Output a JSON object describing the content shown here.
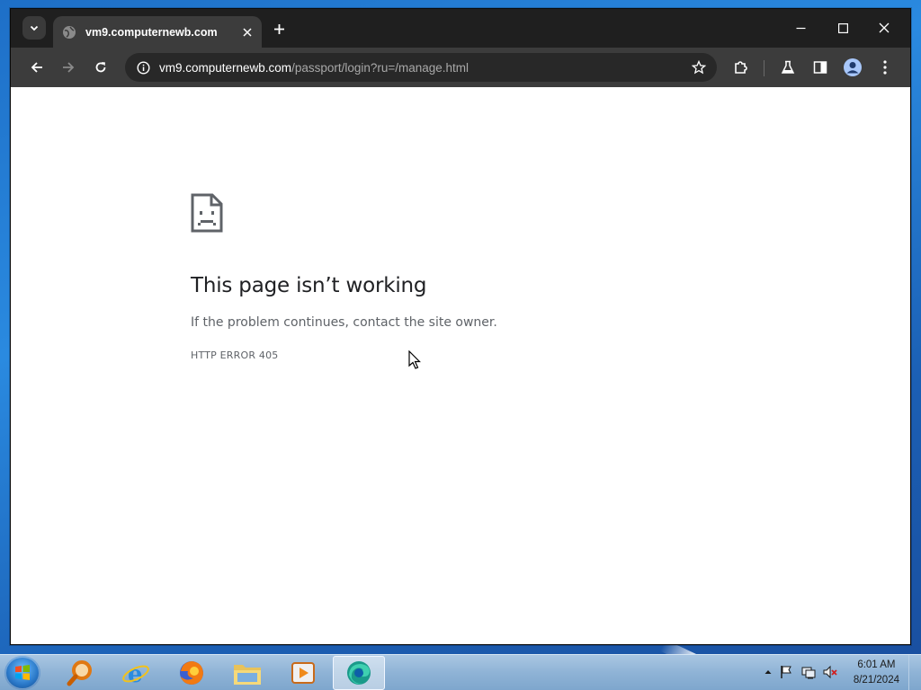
{
  "browser": {
    "tab": {
      "title": "vm9.computernewb.com"
    },
    "address_bar": {
      "host": "vm9.computernewb.com",
      "path": "/passport/login?ru=/manage.html"
    }
  },
  "error_page": {
    "title": "This page isn’t working",
    "description": "If the problem continues, contact the site owner.",
    "error_code": "HTTP ERROR 405"
  },
  "taskbar": {
    "clock": {
      "time": "6:01 AM",
      "date": "8/21/2024"
    },
    "apps": [
      "search-app-icon",
      "internet-explorer-icon",
      "firefox-icon",
      "file-explorer-icon",
      "media-player-icon",
      "edge-icon"
    ]
  },
  "colors": {
    "titlebar": "#1f1f1f",
    "toolbar": "#3c3c3c",
    "omnibox": "#282828",
    "taskbar": "#8fb3d6"
  }
}
